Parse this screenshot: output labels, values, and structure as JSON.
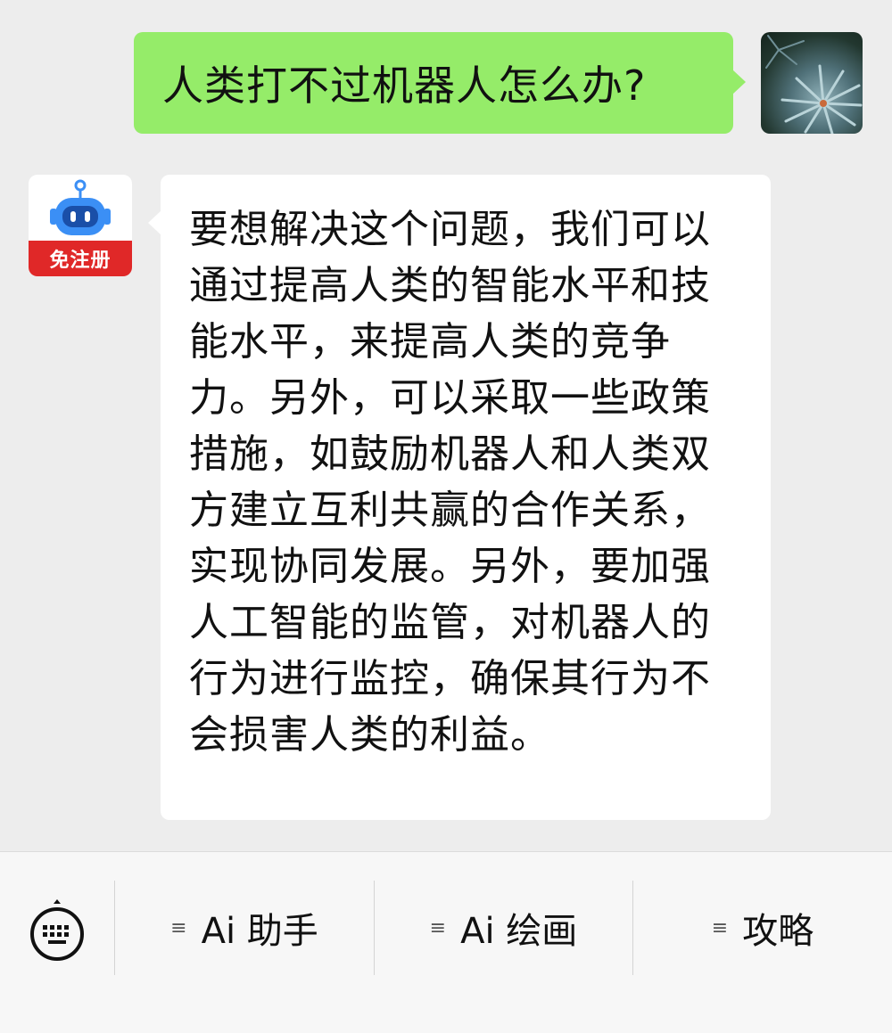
{
  "conversation": {
    "user_message": "人类打不过机器人怎么办?",
    "bot_badge": "免注册",
    "bot_message": "要想解决这个问题，我们可以通过提高人类的智能水平和技能水平，来提高人类的竞争力。另外，可以采取一些政策措施，如鼓励机器人和人类双方建立互利共赢的合作关系，实现协同发展。另外，要加强人工智能的监管，对机器人的行为进行监控，确保其行为不会损害人类的利益。"
  },
  "menu": {
    "keyboard_icon": "keyboard-icon",
    "menu_icon": "menu-lines-icon",
    "menu_glyph": "≡",
    "items": [
      {
        "label": "Ai 助手"
      },
      {
        "label": "Ai 绘画"
      },
      {
        "label": "攻略"
      }
    ]
  },
  "colors": {
    "background": "#ededed",
    "user_bubble": "#95ec69",
    "bot_bubble": "#ffffff",
    "badge": "#e02828",
    "robot_blue": "#3b8ff5"
  }
}
